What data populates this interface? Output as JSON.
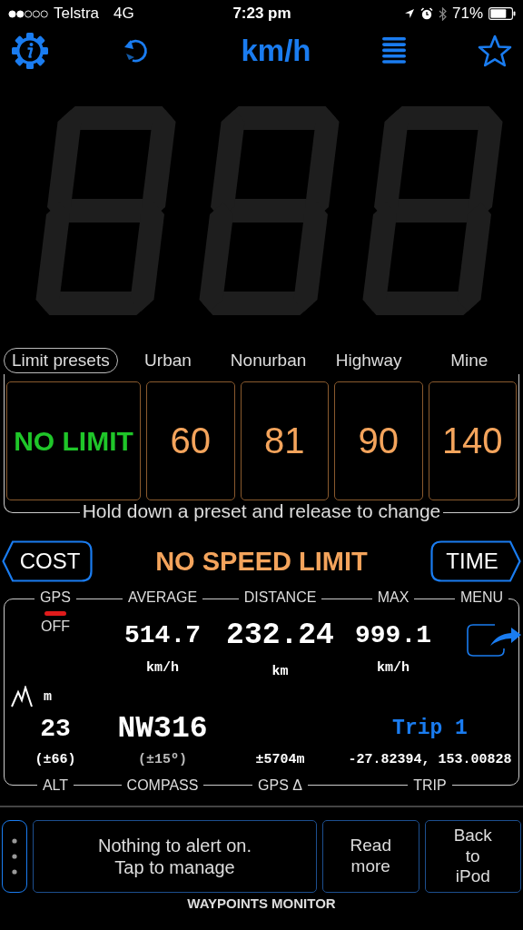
{
  "status_bar": {
    "carrier": "Telstra",
    "network": "4G",
    "time": "7:23 pm",
    "battery": "71%"
  },
  "toolbar": {
    "unit": "km/h"
  },
  "presets": {
    "title": "Limit presets",
    "items": [
      {
        "value": "NO LIMIT",
        "kind": "none"
      },
      {
        "label": "Urban",
        "value": "60",
        "kind": "limit"
      },
      {
        "label": "Nonurban",
        "value": "81",
        "kind": "limit"
      },
      {
        "label": "Highway",
        "value": "90",
        "kind": "limit"
      },
      {
        "label": "Mine",
        "value": "140",
        "kind": "limit"
      }
    ],
    "hint": "Hold down a preset and release to change"
  },
  "limit_bar": {
    "left_button": "COST",
    "status": "NO SPEED LIMIT",
    "right_button": "TIME"
  },
  "stats": {
    "gps": {
      "label": "GPS",
      "status": "OFF",
      "on": false
    },
    "average": {
      "label": "AVERAGE",
      "value": "514.7",
      "unit": "km/h"
    },
    "distance": {
      "label": "DISTANCE",
      "value": "232.24",
      "unit": "km"
    },
    "max": {
      "label": "MAX",
      "value": "999.1",
      "unit": "km/h"
    },
    "menu": {
      "label": "MENU"
    },
    "altitude": {
      "unit": "m",
      "value": "23",
      "accuracy": "(±66)",
      "label": "ALT"
    },
    "compass": {
      "value": "NW316",
      "accuracy": "(±15º)",
      "label": "COMPASS"
    },
    "gps_delta": {
      "value": "±5704m",
      "label": "GPS Δ"
    },
    "trip": {
      "name": "Trip 1",
      "coordinates": "-27.82394, 153.00828",
      "label": "TRIP"
    }
  },
  "bottom_bar": {
    "alert": [
      "Nothing to alert on.",
      "Tap to manage"
    ],
    "read_more": [
      "Read",
      "more"
    ],
    "back": [
      "Back",
      "to",
      "iPod"
    ],
    "title": "WAYPOINTS MONITOR"
  }
}
